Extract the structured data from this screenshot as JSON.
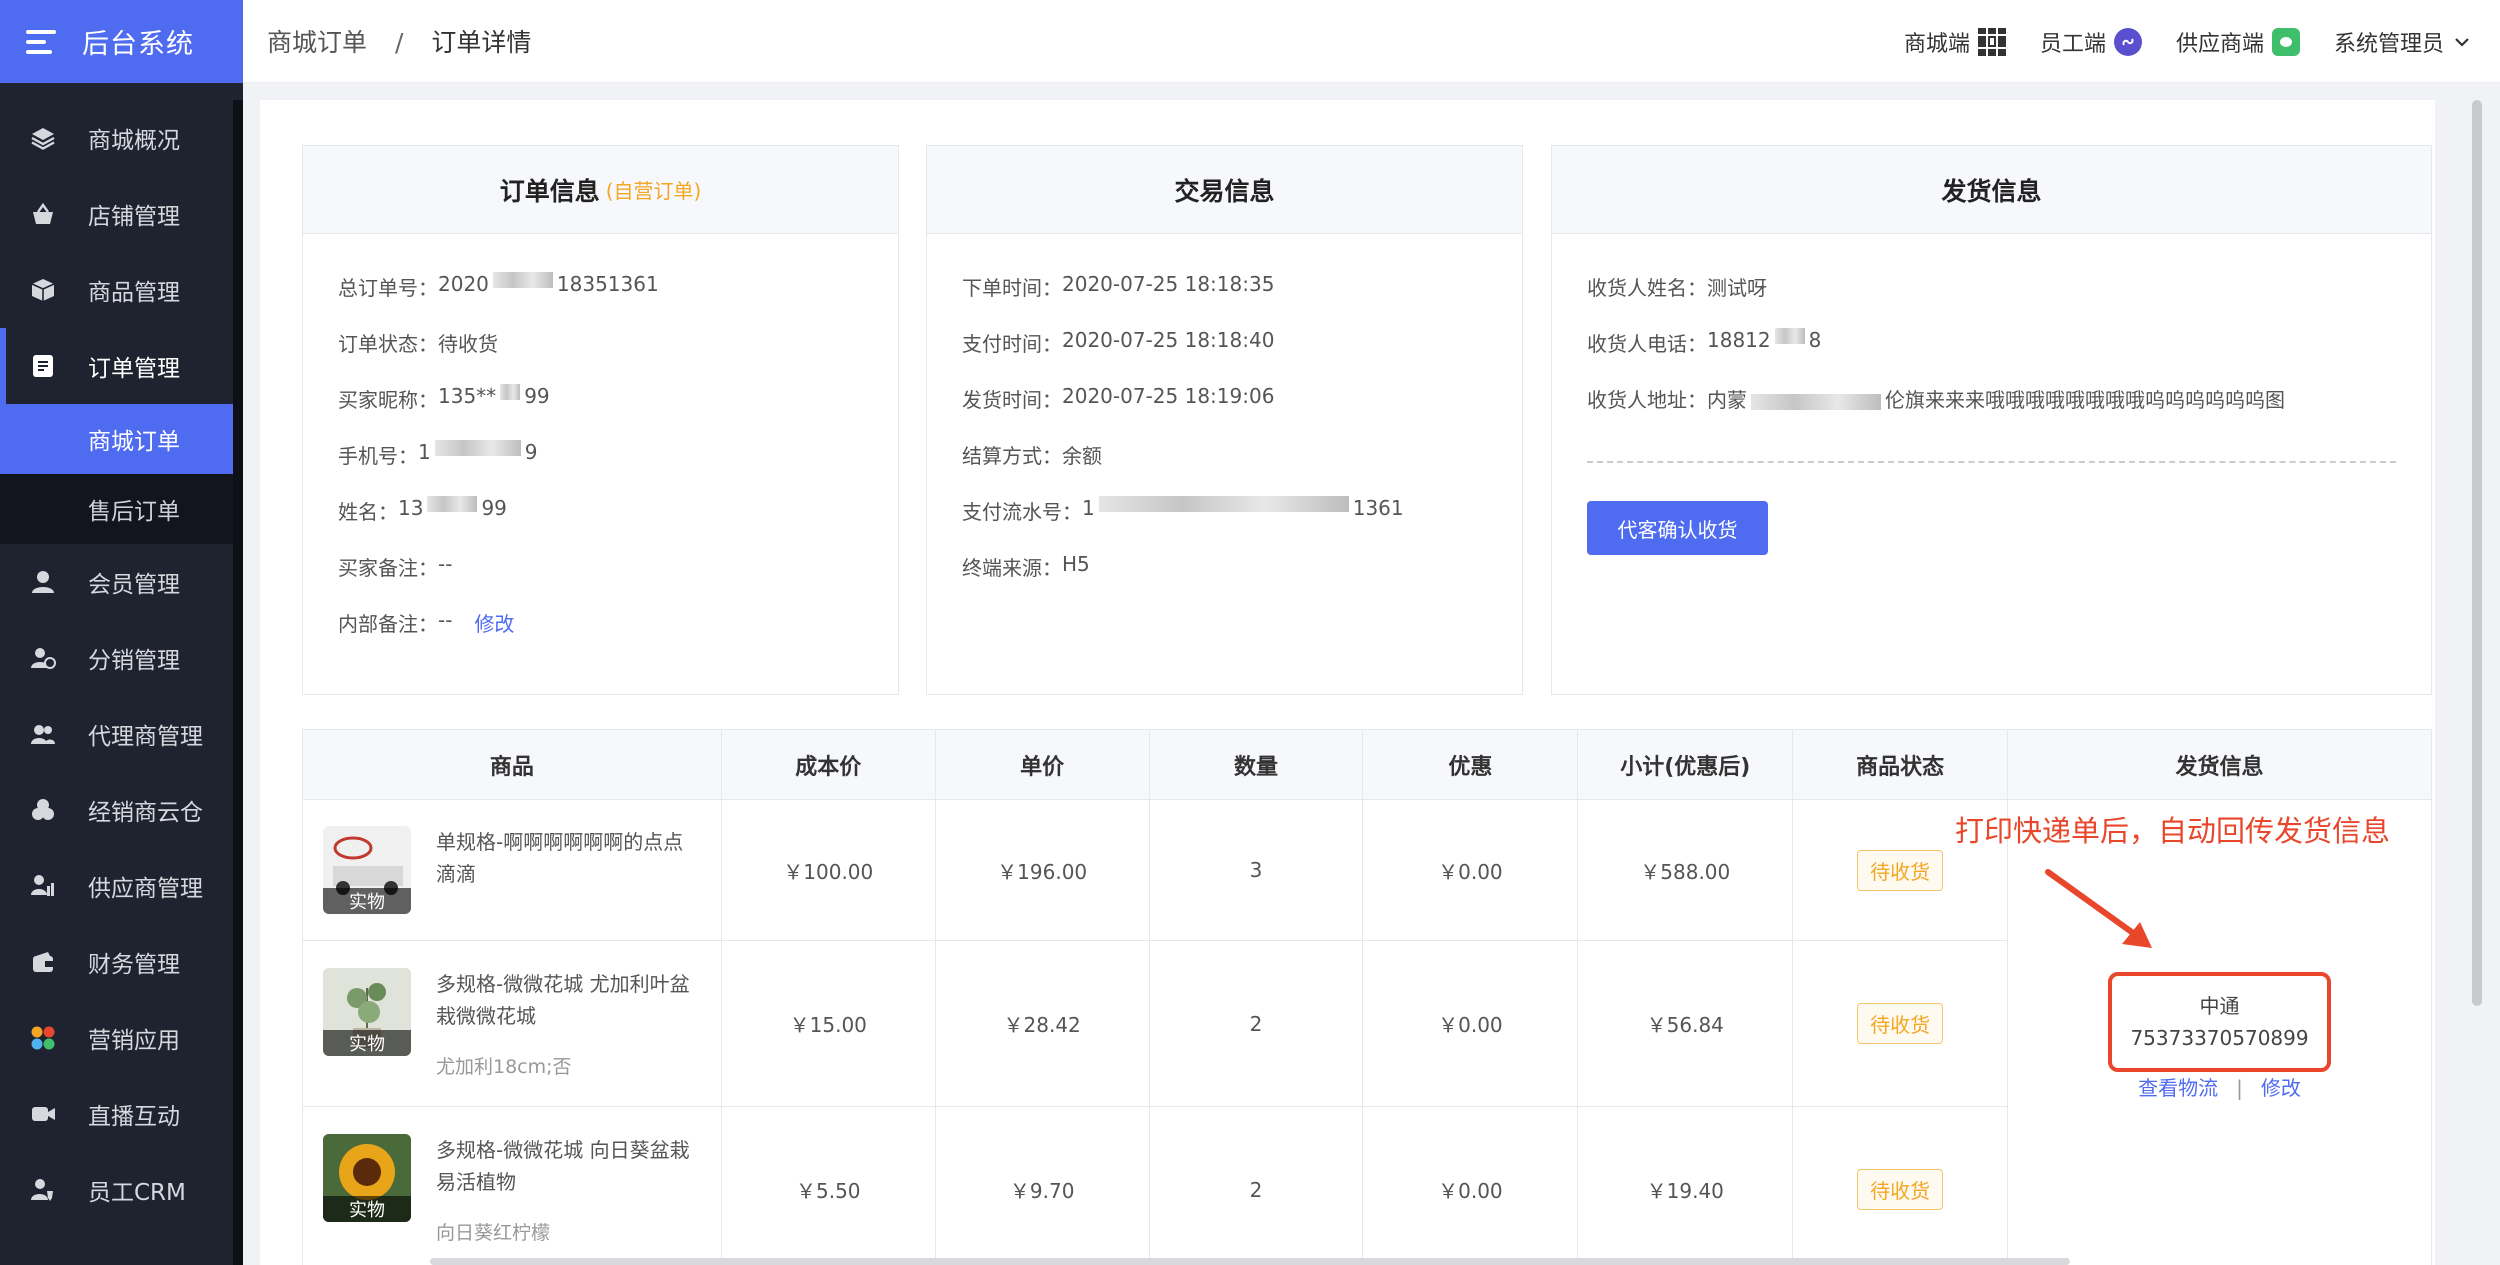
{
  "app": {
    "brand": "后台系统"
  },
  "sidebar": {
    "items": [
      {
        "label": "商城概况",
        "icon": "layers-icon"
      },
      {
        "label": "店铺管理",
        "icon": "basket-icon"
      },
      {
        "label": "商品管理",
        "icon": "box-icon"
      },
      {
        "label": "订单管理",
        "icon": "order-icon"
      },
      {
        "label": "会员管理",
        "icon": "user-icon"
      },
      {
        "label": "分销管理",
        "icon": "distribution-icon"
      },
      {
        "label": "代理商管理",
        "icon": "agent-icon"
      },
      {
        "label": "经销商云仓",
        "icon": "warehouse-icon"
      },
      {
        "label": "供应商管理",
        "icon": "supplier-icon"
      },
      {
        "label": "财务管理",
        "icon": "finance-icon"
      },
      {
        "label": "营销应用",
        "icon": "apps-icon"
      },
      {
        "label": "直播互动",
        "icon": "video-icon"
      },
      {
        "label": "员工CRM",
        "icon": "staff-icon"
      }
    ],
    "sub_items": [
      {
        "label": "商城订单"
      },
      {
        "label": "售后订单"
      }
    ]
  },
  "header": {
    "breadcrumb": [
      "商城订单",
      "订单详情"
    ],
    "separator": "/",
    "right": {
      "mall": "商城端",
      "staff": "员工端",
      "supplier": "供应商端",
      "admin": "系统管理员"
    }
  },
  "order_info": {
    "title": "订单信息",
    "tag": "(自营订单)",
    "rows": [
      {
        "label": "总订单号：",
        "value_a": "2020",
        "value_b": "18351361"
      },
      {
        "label": "订单状态：",
        "value": "待收货"
      },
      {
        "label": "买家昵称：",
        "value_a": "135**",
        "value_b": "99"
      },
      {
        "label": "手机号：",
        "value_a": "1",
        "value_b": "9"
      },
      {
        "label": "姓名：",
        "value_a": "13",
        "value_b": "99"
      },
      {
        "label": "买家备注：",
        "value": "--"
      },
      {
        "label": "内部备注：",
        "value": "--",
        "link": "修改"
      }
    ]
  },
  "trade_info": {
    "title": "交易信息",
    "rows": [
      {
        "label": "下单时间：",
        "value": "2020-07-25 18:18:35"
      },
      {
        "label": "支付时间：",
        "value": "2020-07-25 18:18:40"
      },
      {
        "label": "发货时间：",
        "value": "2020-07-25 18:19:06"
      },
      {
        "label": "结算方式：",
        "value": "余额"
      },
      {
        "label": "支付流水号：",
        "value_a": "1",
        "value_b": "1361"
      },
      {
        "label": "终端来源：",
        "value": "H5"
      }
    ]
  },
  "ship_info": {
    "title": "发货信息",
    "rows": [
      {
        "label": "收货人姓名：",
        "value": "测试呀"
      },
      {
        "label": "收货人电话：",
        "value_a": "18812",
        "value_b": "8"
      }
    ],
    "address_label": "收货人地址：",
    "address_a": "内蒙",
    "address_b": "伦旗来来来哦哦哦哦哦哦哦哦呜呜呜呜呜呜图",
    "confirm_button": "代客确认收货"
  },
  "table": {
    "headers": [
      "商品",
      "成本价",
      "单价",
      "数量",
      "优惠",
      "小计(优惠后)",
      "商品状态",
      "发货信息"
    ],
    "rows": [
      {
        "name": "单规格-啊啊啊啊啊啊的点点滴滴",
        "spec": "",
        "thumb_label": "实物",
        "cost": "￥100.00",
        "price": "￥196.00",
        "qty": "3",
        "discount": "￥0.00",
        "subtotal": "￥588.00",
        "status": "待收货",
        "thumb_color": "#e9e9e9"
      },
      {
        "name": "多规格-微微花城 尤加利叶盆栽微微花城",
        "spec": "尤加利18cm;否",
        "thumb_label": "实物",
        "cost": "￥15.00",
        "price": "￥28.42",
        "qty": "2",
        "discount": "￥0.00",
        "subtotal": "￥56.84",
        "status": "待收货",
        "thumb_color": "#9aae8a"
      },
      {
        "name": "多规格-微微花城 向日葵盆栽易活植物",
        "spec": "向日葵红柠檬",
        "thumb_label": "实物",
        "cost": "￥5.50",
        "price": "￥9.70",
        "qty": "2",
        "discount": "￥0.00",
        "subtotal": "￥19.40",
        "status": "待收货",
        "thumb_color": "#7a3a1a"
      }
    ],
    "shipping": {
      "carrier": "中通",
      "tracking": "75373370570899",
      "view_link": "查看物流",
      "divider": "|",
      "edit_link": "修改"
    }
  },
  "annotation": {
    "text": "打印快递单后，自动回传发货信息"
  },
  "colors": {
    "accent": "#4f6cf0",
    "sidebar_bg": "#1f2330",
    "warning": "#f5a623",
    "annotation": "#e8472b"
  }
}
